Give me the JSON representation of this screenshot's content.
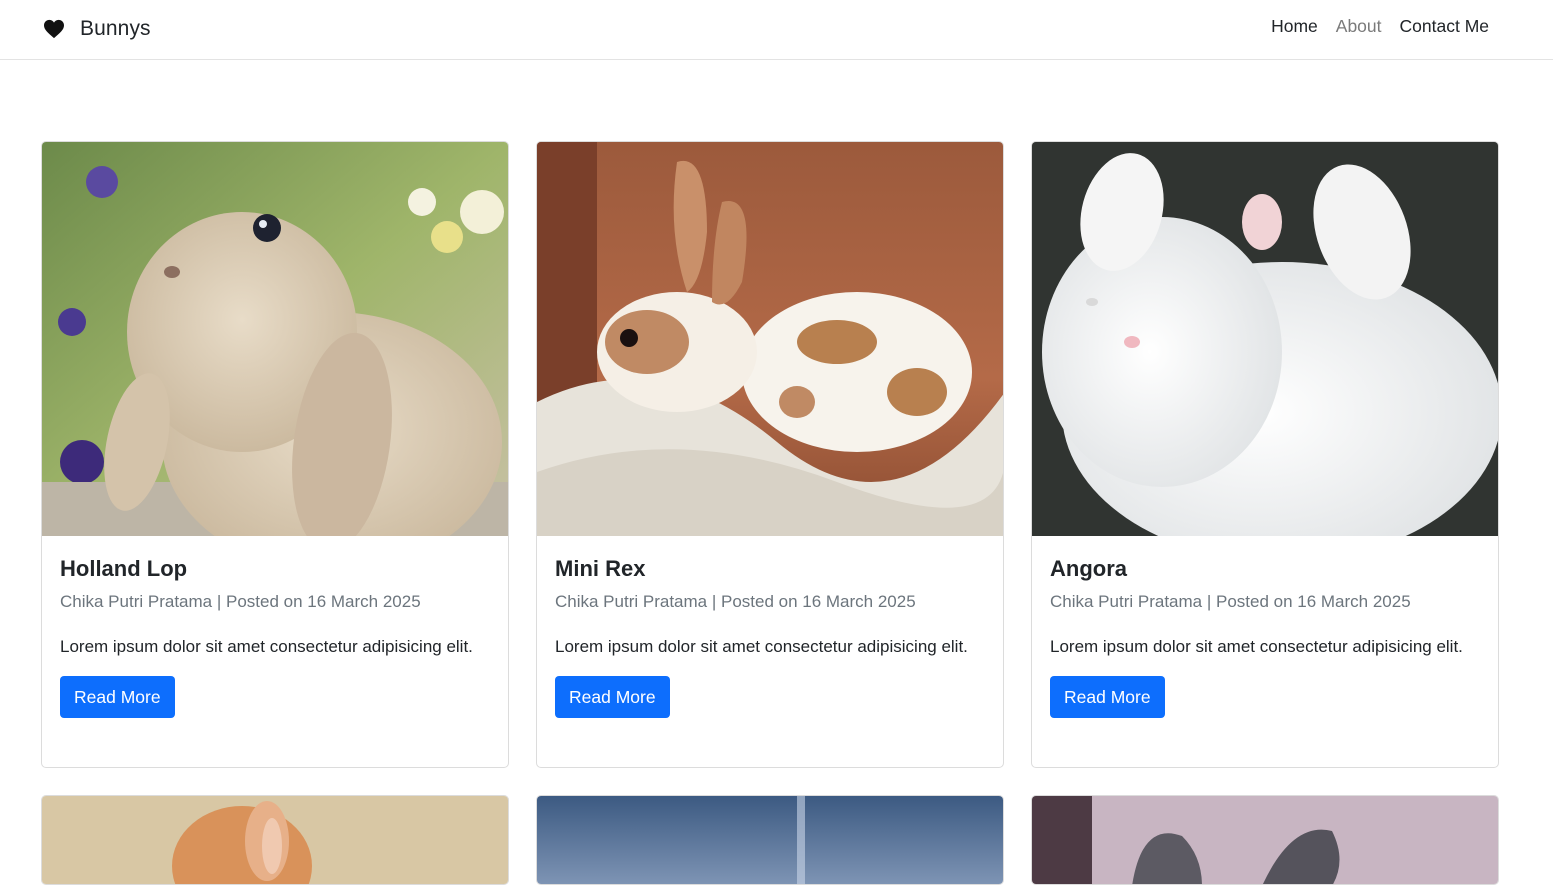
{
  "brand": {
    "name": "Bunnys",
    "icon": "heart-icon"
  },
  "nav": [
    {
      "label": "Home",
      "muted": false
    },
    {
      "label": "About",
      "muted": true
    },
    {
      "label": "Contact Me",
      "muted": false
    }
  ],
  "cards": [
    {
      "title": "Holland Lop",
      "meta": "Chika Putri Pratama | Posted on 16 March 2025",
      "description": "Lorem ipsum dolor sit amet consectetur adipisicing elit.",
      "button": "Read More"
    },
    {
      "title": "Mini Rex",
      "meta": "Chika Putri Pratama | Posted on 16 March 2025",
      "description": "Lorem ipsum dolor sit amet consectetur adipisicing elit.",
      "button": "Read More"
    },
    {
      "title": "Angora",
      "meta": "Chika Putri Pratama | Posted on 16 March 2025",
      "description": "Lorem ipsum dolor sit amet consectetur adipisicing elit.",
      "button": "Read More"
    }
  ],
  "colors": {
    "primary": "#0d6efd",
    "muted": "#6c757d"
  }
}
